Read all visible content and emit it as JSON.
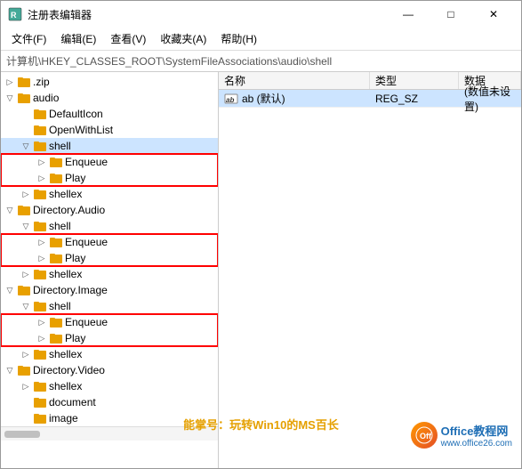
{
  "window": {
    "title": "注册表编辑器",
    "controls": {
      "minimize": "—",
      "maximize": "□",
      "close": "✕"
    }
  },
  "menu": {
    "items": [
      "文件(F)",
      "编辑(E)",
      "查看(V)",
      "收藏夹(A)",
      "帮助(H)"
    ]
  },
  "address": {
    "label": "计算机\\HKEY_CLASSES_ROOT\\SystemFileAssociations\\audio\\shell"
  },
  "tree": {
    "items": [
      {
        "id": "zip",
        "label": ".zip",
        "indent": 0,
        "expanded": false,
        "hasChildren": true
      },
      {
        "id": "audio",
        "label": "audio",
        "indent": 0,
        "expanded": true,
        "hasChildren": true
      },
      {
        "id": "audio-defaulticon",
        "label": "DefaultIcon",
        "indent": 1,
        "expanded": false,
        "hasChildren": false
      },
      {
        "id": "audio-openwithlist",
        "label": "OpenWithList",
        "indent": 1,
        "expanded": false,
        "hasChildren": false
      },
      {
        "id": "audio-shell",
        "label": "shell",
        "indent": 1,
        "expanded": true,
        "hasChildren": true,
        "selected": true
      },
      {
        "id": "audio-shell-enqueue",
        "label": "Enqueue",
        "indent": 2,
        "expanded": false,
        "hasChildren": true,
        "highlighted": true
      },
      {
        "id": "audio-shell-play",
        "label": "Play",
        "indent": 2,
        "expanded": false,
        "hasChildren": true,
        "highlighted": true
      },
      {
        "id": "audio-shellex",
        "label": "shellex",
        "indent": 1,
        "expanded": false,
        "hasChildren": false
      },
      {
        "id": "dir-audio",
        "label": "Directory.Audio",
        "indent": 0,
        "expanded": true,
        "hasChildren": true
      },
      {
        "id": "dir-audio-shell",
        "label": "shell",
        "indent": 1,
        "expanded": true,
        "hasChildren": true
      },
      {
        "id": "dir-audio-shell-enqueue",
        "label": "Enqueue",
        "indent": 2,
        "expanded": false,
        "hasChildren": true,
        "highlighted": true
      },
      {
        "id": "dir-audio-shell-play",
        "label": "Play",
        "indent": 2,
        "expanded": false,
        "hasChildren": true,
        "highlighted": true
      },
      {
        "id": "dir-audio-shellex",
        "label": "shellex",
        "indent": 1,
        "expanded": false,
        "hasChildren": false
      },
      {
        "id": "dir-image",
        "label": "Directory.Image",
        "indent": 0,
        "expanded": true,
        "hasChildren": true
      },
      {
        "id": "dir-image-shell",
        "label": "shell",
        "indent": 1,
        "expanded": true,
        "hasChildren": true
      },
      {
        "id": "dir-image-shell-enqueue",
        "label": "Enqueue",
        "indent": 2,
        "expanded": false,
        "hasChildren": true,
        "highlighted": true
      },
      {
        "id": "dir-image-shell-play",
        "label": "Play",
        "indent": 2,
        "expanded": false,
        "hasChildren": true,
        "highlighted": true
      },
      {
        "id": "dir-image-shellex",
        "label": "shellex",
        "indent": 1,
        "expanded": false,
        "hasChildren": false
      },
      {
        "id": "dir-video",
        "label": "Directory.Video",
        "indent": 0,
        "expanded": true,
        "hasChildren": true
      },
      {
        "id": "dir-video-shellex",
        "label": "shellex",
        "indent": 1,
        "expanded": false,
        "hasChildren": false
      },
      {
        "id": "document",
        "label": "document",
        "indent": 1,
        "expanded": false,
        "hasChildren": false
      },
      {
        "id": "image",
        "label": "image",
        "indent": 1,
        "expanded": false,
        "hasChildren": false
      }
    ]
  },
  "detail": {
    "columns": [
      "名称",
      "类型",
      "数据"
    ],
    "rows": [
      {
        "name": "ab (默认)",
        "type": "REG_SZ",
        "data": "(数值未设置)"
      }
    ]
  },
  "watermark": "能掌号：玩转Win10的MS百长",
  "logo": {
    "text": "Office教程网",
    "url": "www.office26.com"
  },
  "colors": {
    "highlight_border": "#ff0000",
    "folder_yellow": "#e8a000",
    "selected_bg": "#cce4ff",
    "header_bg": "#f5f5f5"
  }
}
